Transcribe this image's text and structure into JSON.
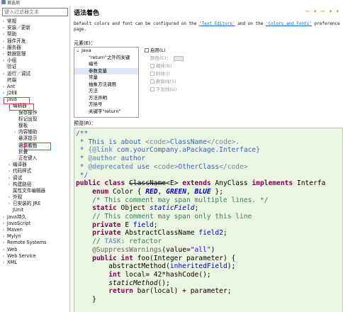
{
  "window": {
    "title": "首选项"
  },
  "filter": {
    "placeholder": "键入过滤器文本"
  },
  "tree": [
    {
      "label": "常规",
      "depth": 0,
      "arrow": "›"
    },
    {
      "label": "安装／更新",
      "depth": 0,
      "arrow": "›"
    },
    {
      "label": "帮助",
      "depth": 0,
      "arrow": "›"
    },
    {
      "label": "插件开发",
      "depth": 0,
      "arrow": "›"
    },
    {
      "label": "服务器",
      "depth": 0,
      "arrow": "›"
    },
    {
      "label": "数据管理",
      "depth": 0,
      "arrow": "›"
    },
    {
      "label": "小组",
      "depth": 0,
      "arrow": "›"
    },
    {
      "label": "验证",
      "depth": 0,
      "arrow": ""
    },
    {
      "label": "运行／调试",
      "depth": 0,
      "arrow": "›"
    },
    {
      "label": "终端",
      "depth": 0,
      "arrow": ""
    },
    {
      "label": "Ant",
      "depth": 0,
      "arrow": "›"
    },
    {
      "label": "J2EE",
      "depth": 0,
      "arrow": "›"
    },
    {
      "label": "Java",
      "depth": 0,
      "arrow": "⌄"
    },
    {
      "label": "编辑器",
      "depth": 1,
      "arrow": "⌄"
    },
    {
      "label": "保存操作",
      "depth": 2,
      "arrow": ""
    },
    {
      "label": "标记出现",
      "depth": 2,
      "arrow": ""
    },
    {
      "label": "模板",
      "depth": 2,
      "arrow": ""
    },
    {
      "label": "内容辅助",
      "depth": 2,
      "arrow": "›"
    },
    {
      "label": "悬浮提示",
      "depth": 2,
      "arrow": ""
    },
    {
      "label": "语法着色",
      "depth": 2,
      "arrow": "",
      "selected": true
    },
    {
      "label": "折叠",
      "depth": 2,
      "arrow": ""
    },
    {
      "label": "正在键入",
      "depth": 2,
      "arrow": ""
    },
    {
      "label": "编译器",
      "depth": 1,
      "arrow": "›"
    },
    {
      "label": "代码样式",
      "depth": 1,
      "arrow": "›"
    },
    {
      "label": "调试",
      "depth": 1,
      "arrow": "›"
    },
    {
      "label": "构建路径",
      "depth": 1,
      "arrow": "›"
    },
    {
      "label": "属性文件编辑器",
      "depth": 1,
      "arrow": ""
    },
    {
      "label": "外观",
      "depth": 1,
      "arrow": "›"
    },
    {
      "label": "已安装的 JRE",
      "depth": 1,
      "arrow": "›"
    },
    {
      "label": "JUnit",
      "depth": 1,
      "arrow": ""
    },
    {
      "label": "Java持久",
      "depth": 0,
      "arrow": "›"
    },
    {
      "label": "JavaScript",
      "depth": 0,
      "arrow": "›"
    },
    {
      "label": "Maven",
      "depth": 0,
      "arrow": "›"
    },
    {
      "label": "Mylyn",
      "depth": 0,
      "arrow": "›"
    },
    {
      "label": "Remote Systems",
      "depth": 0,
      "arrow": "›"
    },
    {
      "label": "Web",
      "depth": 0,
      "arrow": "›"
    },
    {
      "label": "Web Service",
      "depth": 0,
      "arrow": "›"
    },
    {
      "label": "XML",
      "depth": 0,
      "arrow": "›"
    }
  ],
  "page": {
    "title": "语法着色",
    "nav_icons": "⇦ ▾ ⇨ ▾ ▾",
    "desc_before": "Default colors and font can be configured on the ",
    "link1": "'Text Editors'",
    "desc_mid": " and on the ",
    "link2": "'Colors and Fonts'",
    "desc_after": " preference",
    "desc_line2": "page."
  },
  "element": {
    "label": "元素(E)：",
    "items": [
      {
        "label": "Java",
        "indent": 0,
        "arrow": "⌄"
      },
      {
        "label": "\"return\"之外的关键",
        "indent": 1
      },
      {
        "label": "编号",
        "indent": 1
      },
      {
        "label": "参数变量",
        "indent": 1,
        "selected": true
      },
      {
        "label": "常量",
        "indent": 1
      },
      {
        "label": "抽象方法调用",
        "indent": 1
      },
      {
        "label": "方法",
        "indent": 1
      },
      {
        "label": "方法声明",
        "indent": 1
      },
      {
        "label": "方括号",
        "indent": 1
      },
      {
        "label": "关键字\"return\"",
        "indent": 1
      }
    ]
  },
  "options": {
    "enable": "启用(L)",
    "color": "颜色(C)：",
    "bold": "粗体(B)",
    "italic": "斜体(I)",
    "strike": "删除线(S)",
    "underline": "下划线(U)"
  },
  "preview": {
    "label": "预览(R)："
  },
  "code": {
    "l1": "/**",
    "l2a": " * This is about ",
    "l2b": "<code>",
    "l2c": "ClassName",
    "l2d": "</code>",
    "l2e": ".",
    "l3a": " * ",
    "l3b": "{@link",
    "l3c": " com.yourCompany.aPackage.Interface}",
    "l4a": " * ",
    "l4b": "@author",
    "l4c": " author",
    "l5a": " * ",
    "l5b": "@deprecated",
    "l5c": " use ",
    "l5d": "<code>",
    "l5e": "OtherClass",
    "l5f": "</code>",
    "l6": " */",
    "l7a": "public class",
    "l7b": " ",
    "l7c": "ClassName",
    "l7d": "<E> ",
    "l7e": "extends",
    "l7f": " AnyClass ",
    "l7g": "implements",
    "l7h": " Interfa",
    "l8a": "    ",
    "l8b": "enum",
    "l8c": " Color { ",
    "l8d": "RED",
    "l8e": ", ",
    "l8f": "GREEN",
    "l8g": ", ",
    "l8h": "BLUE",
    "l8i": " };",
    "l9": "    /* This comment may span multiple lines. */",
    "l10a": "    ",
    "l10b": "static",
    "l10c": " Object ",
    "l10d": "staticField",
    "l10e": ";",
    "l11": "    // This comment may span only this line",
    "l12a": "    ",
    "l12b": "private",
    "l12c": " E ",
    "l12d": "field",
    "l12e": ";",
    "l13a": "    ",
    "l13b": "private",
    "l13c": " AbstractClassName ",
    "l13d": "field2",
    "l13e": ";",
    "l14a": "    // ",
    "l14b": "TASK",
    "l14c": ": refactor",
    "l15a": "    ",
    "l15b": "@SuppressWarnings",
    "l15c": "(value=",
    "l15d": "\"all\"",
    "l15e": ")",
    "l16a": "    ",
    "l16b": "public int",
    "l16c": " foo(Integer ",
    "l16d": "parameter",
    "l16e": ") {",
    "l17a": "        abstractMethod(",
    "l17b": "inheritedField",
    "l17c": ");",
    "l18a": "        ",
    "l18b": "int",
    "l18c": " local= 42*hashCode();",
    "l19a": "        ",
    "l19b": "staticMethod",
    "l19c": "();",
    "l20a": "        ",
    "l20b": "return",
    "l20c": " bar(local) + ",
    "l20d": "parameter",
    "l20e": ";",
    "l21": "    }"
  }
}
